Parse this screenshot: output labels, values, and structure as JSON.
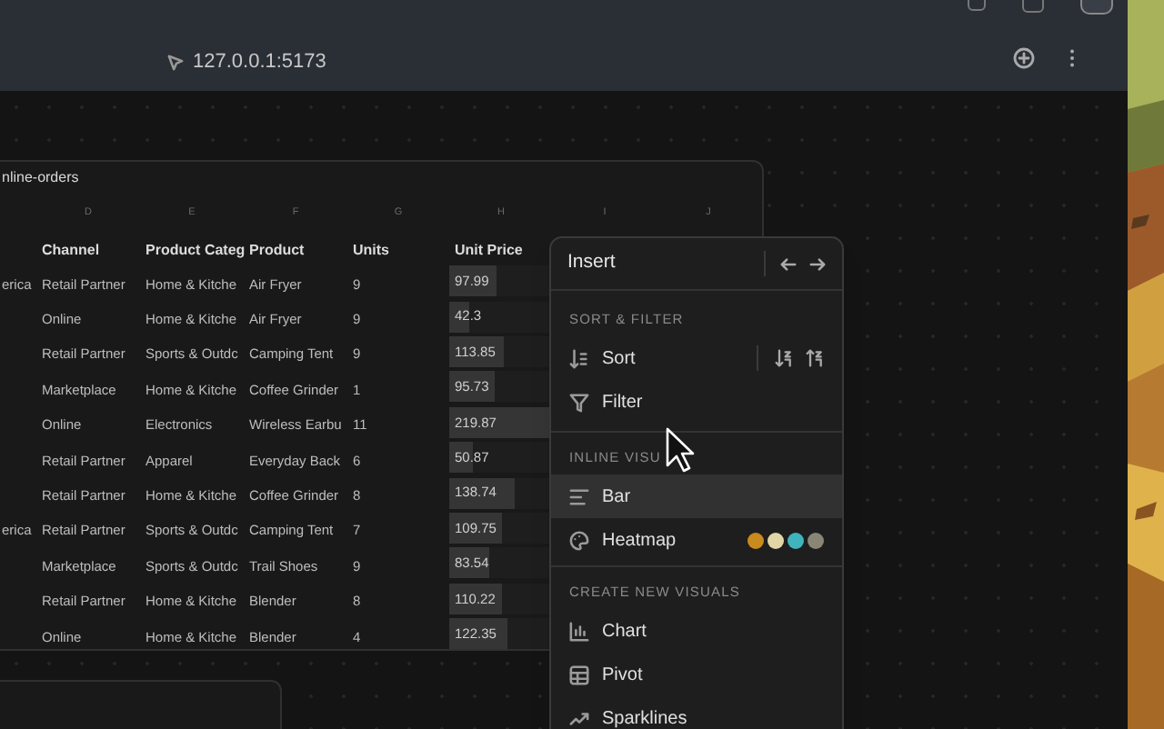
{
  "browser": {
    "address": "127.0.0.1:5173"
  },
  "sheet": {
    "title": "nline-orders",
    "column_letters": [
      "D",
      "E",
      "F",
      "G",
      "H",
      "I",
      "J"
    ],
    "headers": [
      "Channel",
      "Product Categ",
      "Product",
      "Units",
      "Unit Price"
    ],
    "rows": [
      {
        "region": "erica",
        "channel": "Retail Partner",
        "category": "Home & Kitche",
        "product": "Air Fryer",
        "units": "9",
        "unit_price": "97.99",
        "level": 0.45
      },
      {
        "channel": "Online",
        "category": "Home & Kitche",
        "product": "Air Fryer",
        "units": "9",
        "unit_price": "42.3",
        "level": 0.19
      },
      {
        "channel": "Retail Partner",
        "category": "Sports & Outdc",
        "product": "Camping Tent",
        "units": "9",
        "unit_price": "113.85",
        "level": 0.52
      },
      {
        "channel": "Marketplace",
        "category": "Home & Kitche",
        "product": "Coffee Grinder",
        "units": "1",
        "unit_price": "95.73",
        "level": 0.44
      },
      {
        "channel": "Online",
        "category": "Electronics",
        "product": "Wireless Earbu",
        "units": "11",
        "unit_price": "219.87",
        "level": 1
      },
      {
        "channel": "Retail Partner",
        "category": "Apparel",
        "product": "Everyday Back",
        "units": "6",
        "unit_price": "50.87",
        "level": 0.23
      },
      {
        "channel": "Retail Partner",
        "category": "Home & Kitche",
        "product": "Coffee Grinder",
        "units": "8",
        "unit_price": "138.74",
        "level": 0.63
      },
      {
        "region": "erica",
        "channel": "Retail Partner",
        "category": "Sports & Outdc",
        "product": "Camping Tent",
        "units": "7",
        "unit_price": "109.75",
        "level": 0.5
      },
      {
        "channel": "Marketplace",
        "category": "Sports & Outdc",
        "product": "Trail Shoes",
        "units": "9",
        "unit_price": "83.54",
        "level": 0.38
      },
      {
        "channel": "Retail Partner",
        "category": "Home & Kitche",
        "product": "Blender",
        "units": "8",
        "unit_price": "110.22",
        "level": 0.5
      },
      {
        "channel": "Online",
        "category": "Home & Kitche",
        "product": "Blender",
        "units": "4",
        "unit_price": "122.35",
        "level": 0.56
      }
    ]
  },
  "menu": {
    "title": "Insert",
    "sections": [
      {
        "label": "SORT & FILTER",
        "items": [
          {
            "label": "Sort",
            "kind": "sort",
            "selected": false
          },
          {
            "label": "Filter",
            "kind": "plain",
            "selected": false
          }
        ]
      },
      {
        "label": "INLINE VISU",
        "items": [
          {
            "label": "Bar",
            "kind": "plain",
            "selected": true
          },
          {
            "label": "Heatmap",
            "kind": "swatches",
            "selected": false,
            "swatches": [
              {
                "color": "#c98a1e"
              },
              {
                "color": "#e2d6a6"
              },
              {
                "color": "#3fb4bd"
              },
              {
                "color": "#8a8676"
              }
            ]
          }
        ]
      },
      {
        "label": "CREATE NEW VISUALS",
        "items": [
          {
            "label": "Chart",
            "kind": "plain",
            "selected": false
          },
          {
            "label": "Pivot",
            "kind": "plain",
            "selected": false
          },
          {
            "label": "Sparklines",
            "kind": "plain",
            "selected": false
          }
        ]
      }
    ]
  }
}
